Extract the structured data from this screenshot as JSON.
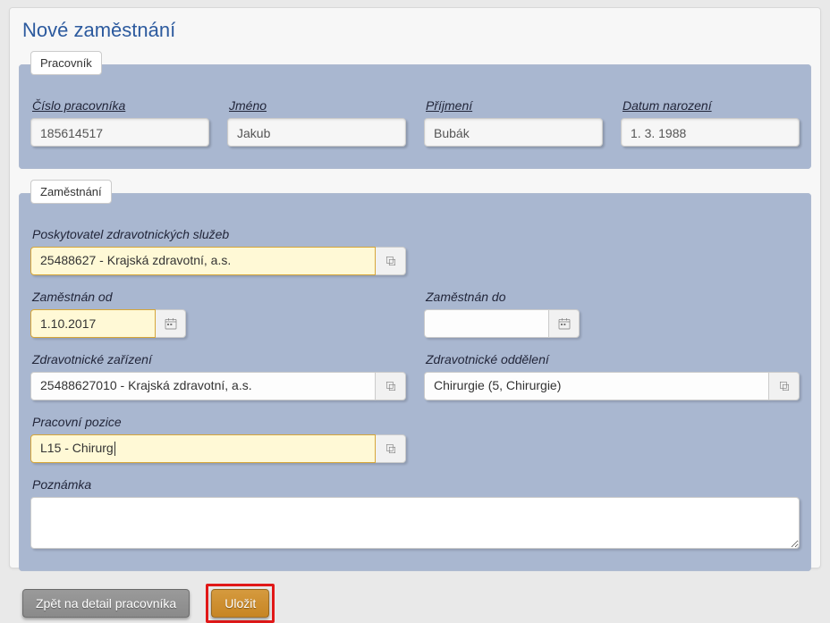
{
  "page": {
    "title": "Nové zaměstnání"
  },
  "groups": {
    "worker_legend": "Pracovník",
    "employment_legend": "Zaměstnání"
  },
  "worker": {
    "number_label": "Číslo pracovníka",
    "number_value": "185614517",
    "firstname_label": "Jméno",
    "firstname_value": "Jakub",
    "lastname_label": "Příjmení",
    "lastname_value": "Bubák",
    "dob_label": "Datum narození",
    "dob_value": "1. 3. 1988"
  },
  "employment": {
    "provider_label": "Poskytovatel zdravotnických služeb",
    "provider_value": "25488627 - Krajská zdravotní, a.s.",
    "from_label": "Zaměstnán od",
    "from_value": "1.10.2017",
    "to_label": "Zaměstnán do",
    "to_value": "",
    "facility_label": "Zdravotnické zařízení",
    "facility_value": "25488627010 - Krajská zdravotní, a.s.",
    "department_label": "Zdravotnické oddělení",
    "department_value": "Chirurgie (5, Chirurgie)",
    "position_label": "Pracovní pozice",
    "position_value": "L15 - Chirurg",
    "note_label": "Poznámka",
    "note_value": ""
  },
  "buttons": {
    "back": "Zpět na detail pracovníka",
    "save": "Uložit"
  }
}
